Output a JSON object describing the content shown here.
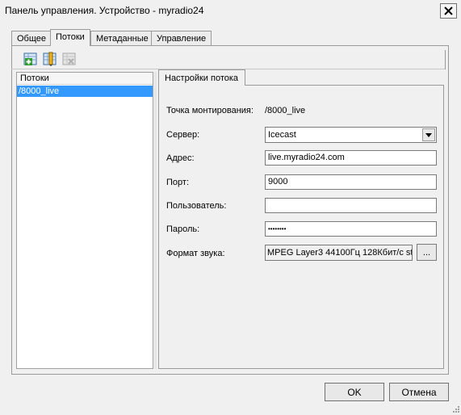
{
  "window": {
    "title": "Панель управления. Устройство - myradio24",
    "close_glyph": "X"
  },
  "tabs": [
    {
      "label": "Общее"
    },
    {
      "label": "Потоки",
      "active": true
    },
    {
      "label": "Метаданные"
    },
    {
      "label": "Управление"
    }
  ],
  "toolbar": {
    "icons": [
      "add-stream-icon",
      "edit-stream-icon",
      "delete-stream-icon"
    ]
  },
  "streams": {
    "header": "Потоки",
    "items": [
      "/8000_live"
    ]
  },
  "settings": {
    "tab_label": "Настройки потока",
    "mount_label": "Точка монтирования:",
    "mount_value": "/8000_live",
    "server_label": "Сервер:",
    "server_value": "Icecast",
    "address_label": "Адрес:",
    "address_value": "live.myradio24.com",
    "port_label": "Порт:",
    "port_value": "9000",
    "user_label": "Пользователь:",
    "user_value": "",
    "password_label": "Пароль:",
    "password_value": "••••••••",
    "format_label": "Формат звука:",
    "format_value": "MPEG Layer3 44100Гц 128Кбит/с st",
    "format_button": "..."
  },
  "buttons": {
    "ok": "OK",
    "cancel": "Отмена"
  },
  "colors": {
    "selection": "#3399ff",
    "accent_green": "#2e9b2e"
  }
}
